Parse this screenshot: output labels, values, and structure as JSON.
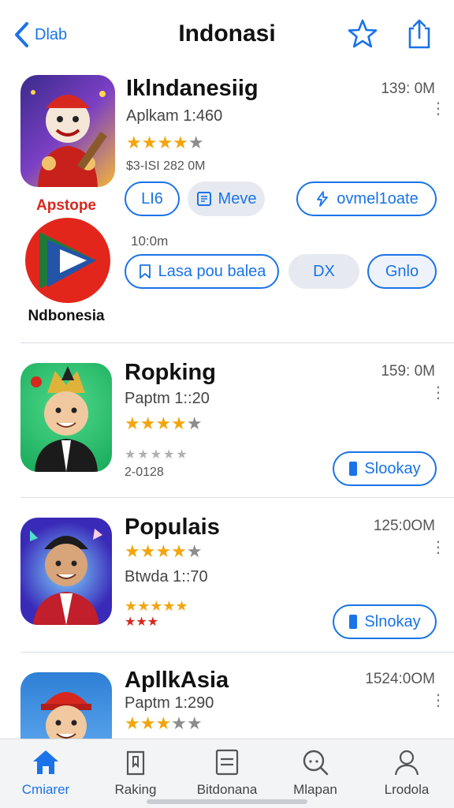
{
  "header": {
    "back_label": "Dlab",
    "title": "Indonasi",
    "star_icon": "star-icon",
    "share_icon": "share-icon"
  },
  "featured": {
    "name": "Iklndanesiig",
    "subtitle": "Aplkam 1:460",
    "size": "139: 0M",
    "rating": 4.5,
    "meta": "$3-ISI 282 0M",
    "pill_left": "LI6",
    "pill_view": "Meve",
    "pill_download": "ovmel1oate",
    "time": "10:0m",
    "pill_lasa": "Lasa pou balea",
    "pill_close": "DX",
    "pill_gnlo": "Gnlo",
    "brand_top": "Apstope",
    "brand_bottom": "Ndbonesia"
  },
  "apps": [
    {
      "name": "Ropking",
      "subtitle": "Paptm 1::20",
      "size": "159: 0M",
      "rating": 4.5,
      "meta": "2-0128",
      "button": "Slookay"
    },
    {
      "name": "Populais",
      "subtitle": "Btwda 1::70",
      "size": "125:0OM",
      "rating": 3.5,
      "button": "Slnokay"
    },
    {
      "name": "ApllkAsia",
      "subtitle": "Paptm 1:290",
      "size": "1524:0OM",
      "rating": 3.5
    }
  ],
  "tabs": [
    {
      "label": "Cmiarer",
      "icon": "home-icon",
      "active": true
    },
    {
      "label": "Raking",
      "icon": "bookmark-icon",
      "active": false
    },
    {
      "label": "Bitdonana",
      "icon": "list-icon",
      "active": false
    },
    {
      "label": "Mlapan",
      "icon": "search-icon",
      "active": false
    },
    {
      "label": "Lrodola",
      "icon": "profile-icon",
      "active": false
    }
  ],
  "colors": {
    "accent": "#1a73e8",
    "star": "#f2a60c"
  }
}
